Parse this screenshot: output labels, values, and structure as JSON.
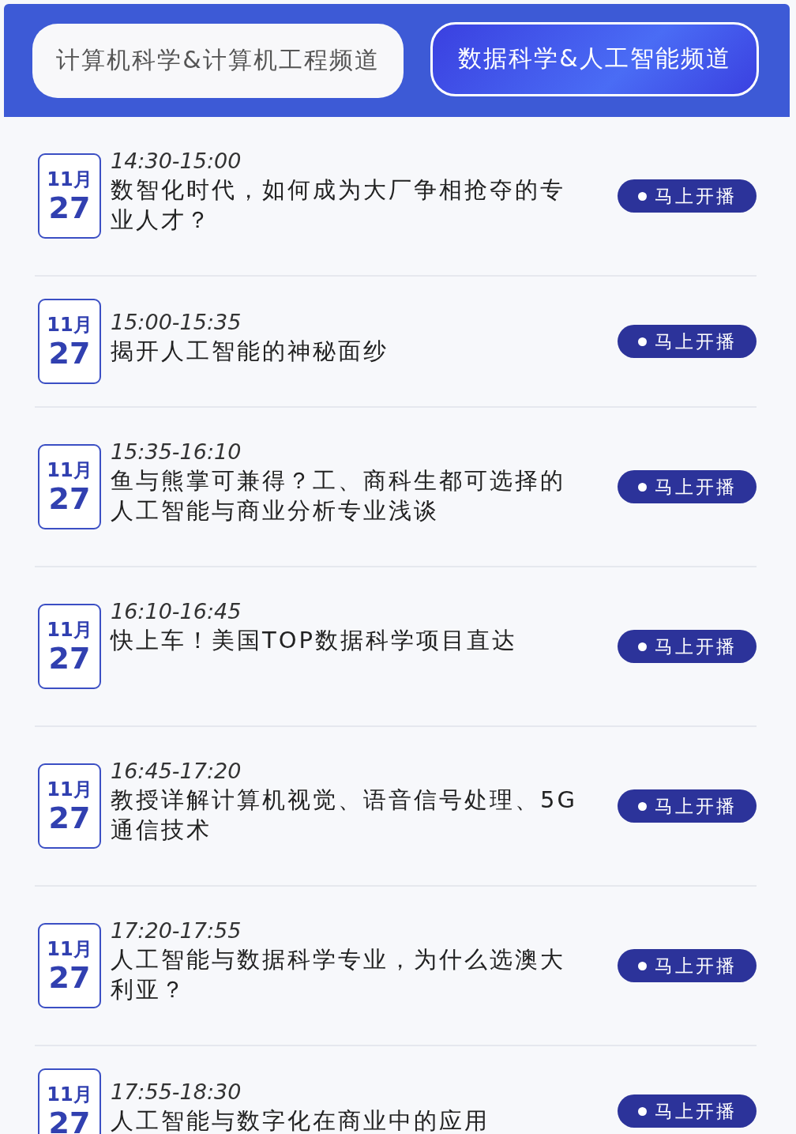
{
  "tabs": [
    {
      "label": "计算机科学&计算机工程频道",
      "selected": false
    },
    {
      "label": "数据科学&人工智能频道",
      "selected": true
    }
  ],
  "sessions": [
    {
      "month": "11月",
      "day": "27",
      "time": "14:30-15:00",
      "title": "数智化时代，如何成为大厂争相抢夺的专业人才？",
      "button": "马上开播"
    },
    {
      "month": "11月",
      "day": "27",
      "time": "15:00-15:35",
      "title": "揭开人工智能的神秘面纱",
      "button": "马上开播"
    },
    {
      "month": "11月",
      "day": "27",
      "time": "15:35-16:10",
      "title": "鱼与熊掌可兼得？工、商科生都可选择的人工智能与商业分析专业浅谈",
      "button": "马上开播"
    },
    {
      "month": "11月",
      "day": "27",
      "time": "16:10-16:45",
      "title": "快上车！美国TOP数据科学项目直达",
      "button": "马上开播"
    },
    {
      "month": "11月",
      "day": "27",
      "time": "16:45-17:20",
      "title": "教授详解计算机视觉、语音信号处理、5G通信技术",
      "button": "马上开播"
    },
    {
      "month": "11月",
      "day": "27",
      "time": "17:20-17:55",
      "title": "人工智能与数据科学专业，为什么选澳大利亚？",
      "button": "马上开播"
    },
    {
      "month": "11月",
      "day": "27",
      "time": "17:55-18:30",
      "title": "人工智能与数字化在商业中的应用",
      "button": "马上开播"
    }
  ]
}
